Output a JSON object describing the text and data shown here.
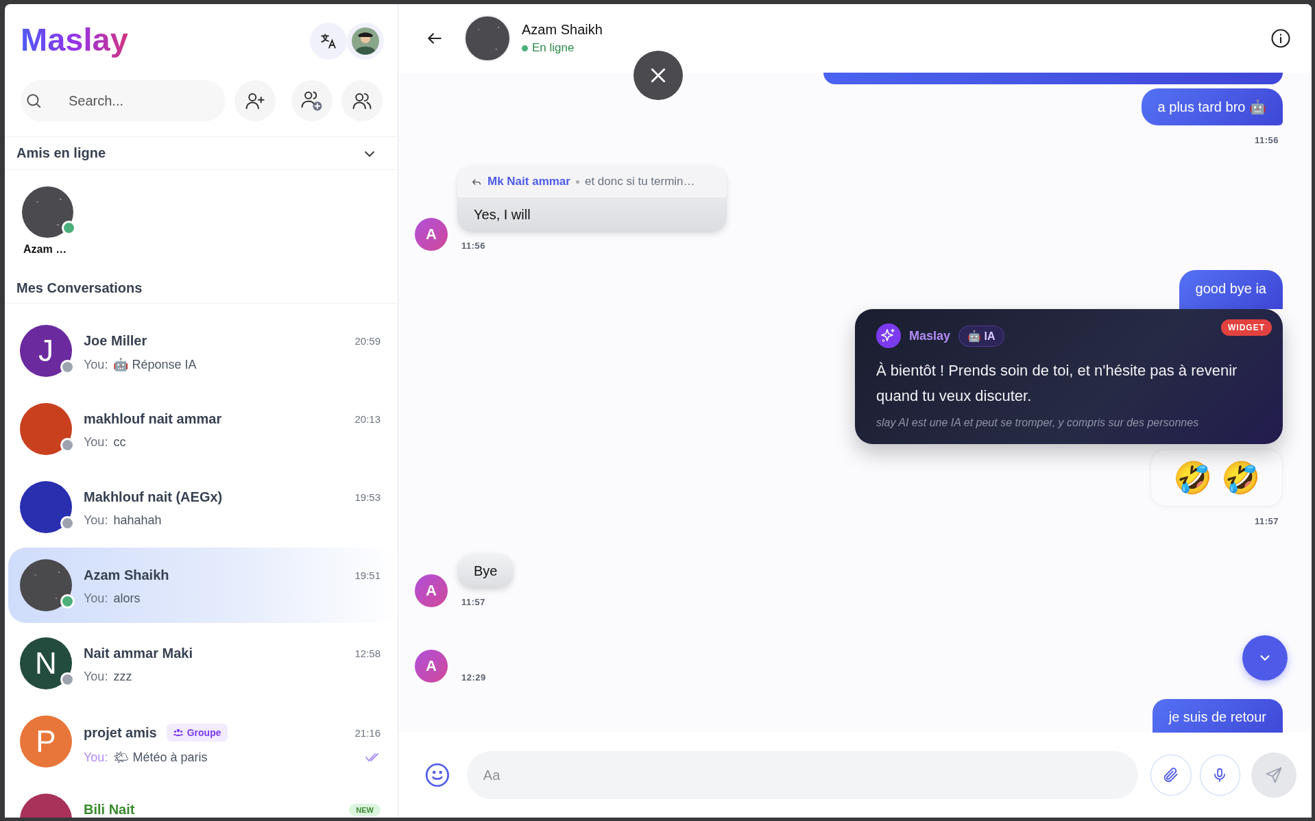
{
  "sidebar": {
    "logo": "Maslay",
    "search": {
      "placeholder": "Search..."
    },
    "online_section": {
      "title": "Amis en ligne",
      "expanded": true,
      "friends": [
        {
          "name": "Azam …",
          "online": true
        }
      ]
    },
    "conversations_title": "Mes Conversations",
    "conversations": [
      {
        "name": "Joe Miller",
        "kind": "direct",
        "initial": "J",
        "color": "#6b2a9e",
        "online": false,
        "selected": false,
        "you": "You:",
        "preview": "🤖 Réponse IA",
        "time": "20:59"
      },
      {
        "name": "makhlouf nait ammar",
        "kind": "direct",
        "color": "#c8401e",
        "online": false,
        "selected": false,
        "you": "You:",
        "preview": "cc",
        "time": "20:13"
      },
      {
        "name": "Makhlouf nait (AEGx)",
        "kind": "direct",
        "color": "#2a2fb0",
        "online": false,
        "selected": false,
        "you": "You:",
        "preview": "hahahah",
        "time": "19:53"
      },
      {
        "name": "Azam Shaikh",
        "kind": "direct",
        "color": "#4a494c",
        "online": true,
        "selected": true,
        "you": "You:",
        "preview": "alors",
        "time": "19:51"
      },
      {
        "name": "Nait ammar Maki",
        "kind": "direct",
        "initial": "N",
        "color": "#234c3f",
        "online": false,
        "selected": false,
        "you": "You:",
        "preview": "zzz",
        "time": "12:58"
      },
      {
        "name": "projet amis",
        "kind": "group",
        "badge": "Groupe",
        "initial": "P",
        "color": "#e8763a",
        "selected": false,
        "you": "You:",
        "preview": "🌤 Météo à paris",
        "time": "21:16",
        "read": true
      },
      {
        "name": "Bili Nait",
        "kind": "direct",
        "color": "#a8325a",
        "selected": false,
        "unread": true,
        "new_badge": "NEW"
      }
    ]
  },
  "chat": {
    "contact": {
      "name": "Azam Shaikh",
      "status": "En ligne",
      "online": true
    },
    "messages": [
      {
        "kind": "cut"
      },
      {
        "kind": "outgoing",
        "text": "a plus tard  bro 🤖",
        "time": "11:56"
      },
      {
        "kind": "incoming",
        "initial": "A",
        "reply_to": {
          "author": "Mk Nait ammar",
          "excerpt": "et donc si tu termin…"
        },
        "text": "Yes, I will",
        "time": "11:56"
      },
      {
        "kind": "outgoing",
        "text": "good bye ia"
      },
      {
        "kind": "ai",
        "author": "Maslay",
        "badge": "🤖 IA",
        "tag": "WIDGET",
        "text": "À bientôt ! Prends soin de toi, et n'hésite pas à revenir quand tu veux discuter.",
        "disclaimer": "slay AI est une IA et peut se tromper, y compris sur des personnes"
      },
      {
        "kind": "emoji",
        "text": "🤣 🤣",
        "time": "11:57"
      },
      {
        "kind": "incoming",
        "initial": "A",
        "text": "Bye",
        "time": "11:57"
      },
      {
        "kind": "incoming",
        "initial": "A",
        "time": "12:29"
      },
      {
        "kind": "outgoing",
        "text": "je suis de retour"
      }
    ],
    "input": {
      "placeholder": "Aa"
    }
  }
}
